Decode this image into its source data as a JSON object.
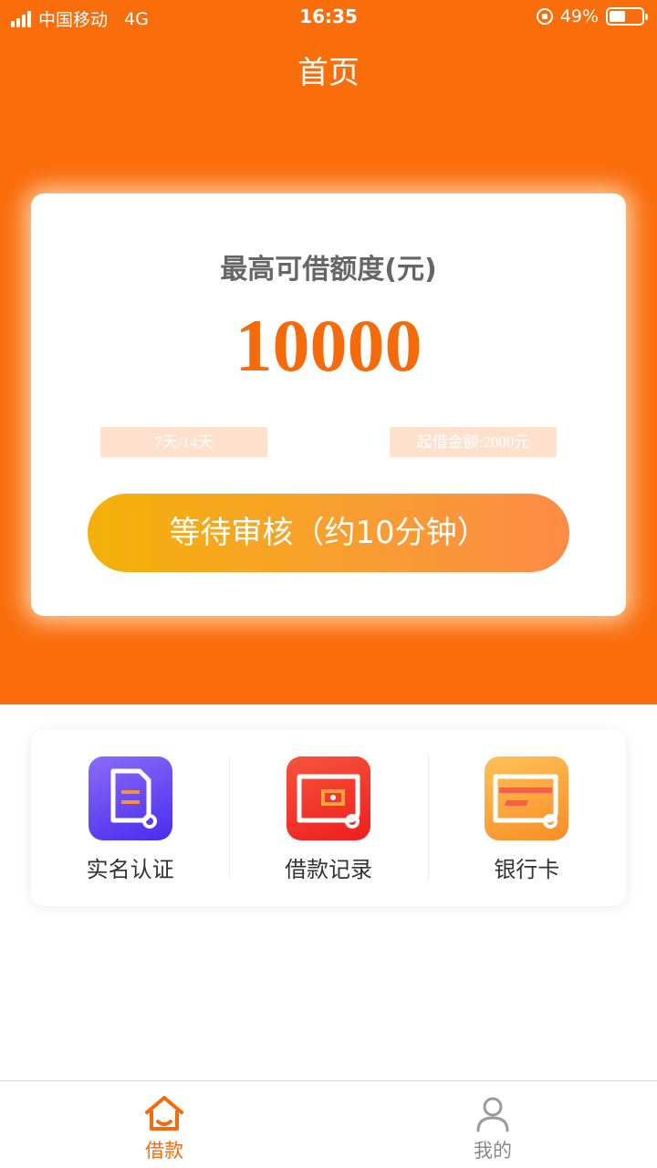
{
  "status_bar": {
    "carrier": "中国移动",
    "network": "4G",
    "time": "16:35",
    "battery_percent": "49%",
    "battery_level": 0.49
  },
  "nav": {
    "title": "首页"
  },
  "quota_card": {
    "label": "最高可借额度(元)",
    "amount": "10000",
    "term_tag": "7天/14天",
    "min_tag": "起借金额:2000元",
    "review_button": "等待审核（约10分钟）"
  },
  "menu": {
    "items": [
      {
        "label": "实名认证",
        "icon": "id-document-icon"
      },
      {
        "label": "借款记录",
        "icon": "loan-record-icon"
      },
      {
        "label": "银行卡",
        "icon": "bank-card-icon"
      }
    ]
  },
  "tab_bar": {
    "tabs": [
      {
        "label": "借款",
        "icon": "home-icon",
        "active": true
      },
      {
        "label": "我的",
        "icon": "user-icon",
        "active": false
      }
    ]
  },
  "colors": {
    "brand_orange": "#f96d0b",
    "amount_orange": "#f56a0a",
    "button_gradient_start": "#f4b108",
    "button_gradient_end": "#fd8b45"
  }
}
